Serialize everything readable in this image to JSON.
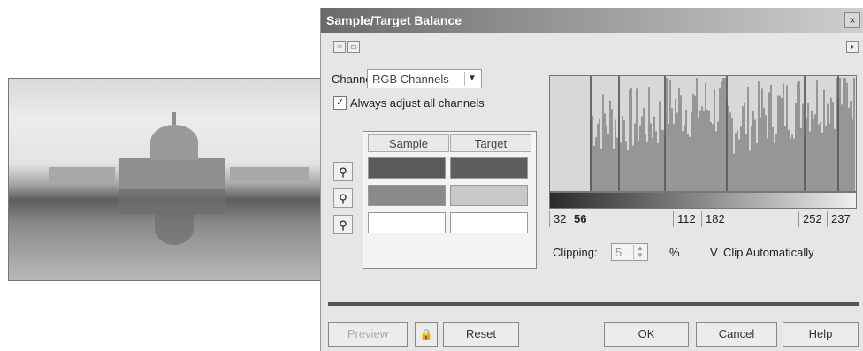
{
  "dialog": {
    "title": "Sample/Target Balance",
    "close_glyph": "×",
    "toolbar": {
      "btn1": "▫▫",
      "btn2": "▭",
      "arrow": "▸"
    },
    "channel": {
      "label": "Channel:",
      "value": "RGB Channels",
      "arrow": "▼"
    },
    "adjust_all": {
      "label": "Always adjust all channels",
      "checked": true,
      "check_glyph": "✓"
    },
    "table": {
      "headers": [
        "Sample",
        "Target"
      ],
      "rows": [
        {
          "eyedropper": "⚲",
          "sample_color": "#5a5a5a",
          "target_color": "#5e5e5e"
        },
        {
          "eyedropper": "⚲",
          "sample_color": "#8a8a8a",
          "target_color": "#c8c8c8"
        },
        {
          "eyedropper": "⚲",
          "sample_color": "#ffffff",
          "target_color": "#ffffff"
        }
      ]
    },
    "histogram": {
      "input_low": "32",
      "input_high": "56",
      "mid_left": "112",
      "mid_right": "182",
      "output_low": "252",
      "output_high": "237"
    },
    "clipping": {
      "label": "Clipping:",
      "value": "5",
      "unit": "%",
      "auto_prefix": "V",
      "auto_label": "Clip Automatically"
    },
    "buttons": {
      "preview": "Preview",
      "lock": "🔒",
      "reset": "Reset",
      "ok": "OK",
      "cancel": "Cancel",
      "help": "Help"
    }
  }
}
